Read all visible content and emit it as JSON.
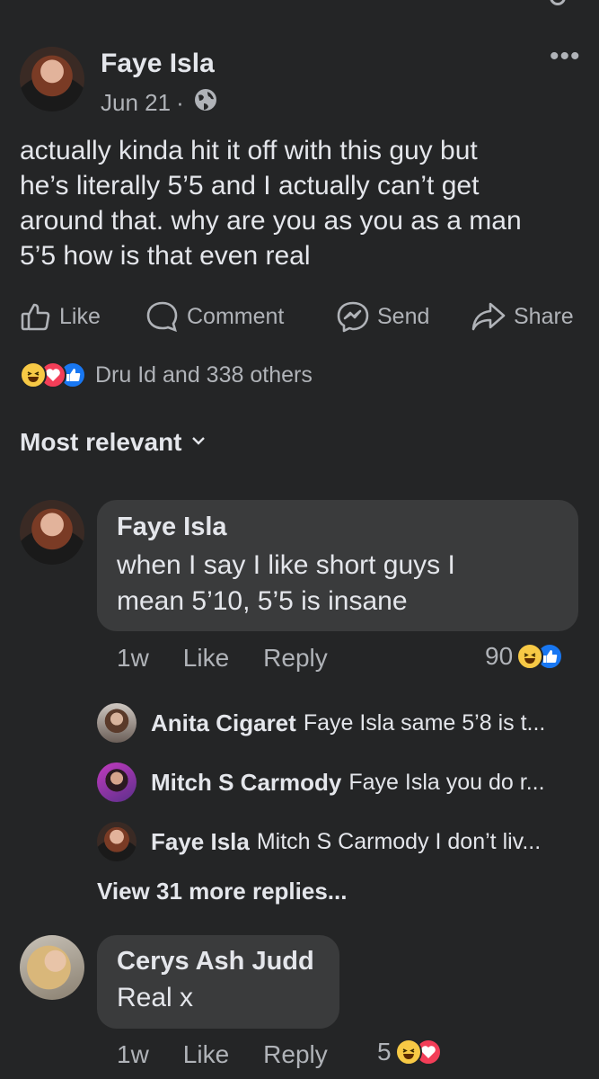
{
  "post": {
    "author": "Faye Isla",
    "date": "Jun 21",
    "dot": "·",
    "more_icon": "more-dots-icon",
    "text_lines": [
      "actually kinda hit it off with this guy but",
      "he’s literally 5’5 and I actually can’t get",
      "around that. why are you as you as a man",
      "5’5 how is that even real"
    ]
  },
  "actions": {
    "like": "Like",
    "comment": "Comment",
    "send": "Send",
    "share": "Share"
  },
  "reactions": {
    "summary": "Dru Id and 338 others"
  },
  "filter": {
    "label": "Most relevant"
  },
  "comments": [
    {
      "author": "Faye Isla",
      "lines": [
        "when I say I like short guys I",
        "mean 5’10, 5’5 is insane"
      ],
      "time": "1w",
      "like": "Like",
      "reply": "Reply",
      "reaction_count": "90"
    },
    {
      "author": "Cerys Ash Judd",
      "lines": [
        "Real x"
      ],
      "time": "1w",
      "like": "Like",
      "reply": "Reply",
      "reaction_count": "5"
    }
  ],
  "replies": [
    {
      "author": "Anita Cigaret",
      "text": "Faye Isla same 5’8 is t..."
    },
    {
      "author": "Mitch S Carmody",
      "text": "Faye Isla you do r..."
    },
    {
      "author": "Faye Isla",
      "text": "Mitch S Carmody I don’t liv..."
    }
  ],
  "view_more": "View 31 more replies...",
  "colors": {
    "background": "#242526",
    "bubble": "#3a3b3c",
    "primary_text": "#e4e6eb",
    "secondary_text": "#b0b3b8",
    "like_blue": "#1877f2",
    "love_red": "#f33e58",
    "haha_yellow": "#f7c945"
  }
}
